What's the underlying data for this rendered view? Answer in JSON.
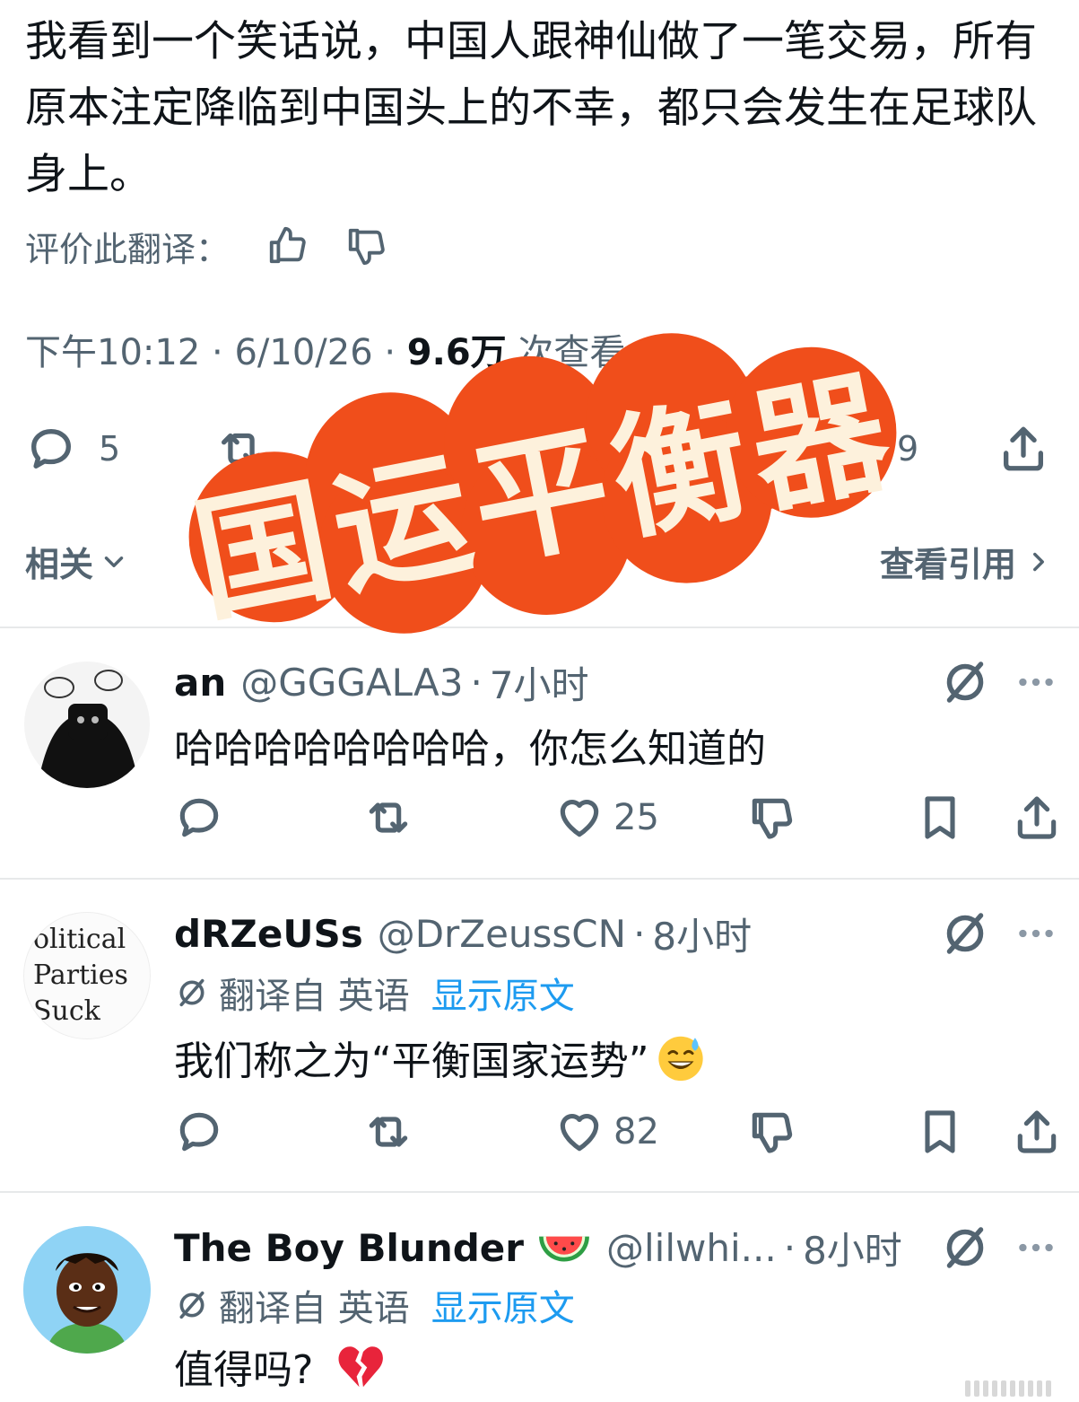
{
  "tweet": {
    "text": "我看到一个笑话说，中国人跟神仙做了一笔交易，所有原本注定降临到中国头上的不幸，都只会发生在足球队身上。",
    "rate_label": "评价此翻译：",
    "time": "下午10:12",
    "date": "6/10/26",
    "views_count": "9.6万",
    "views_label": "次查看",
    "reply_count": "5",
    "like_count_partial": "9",
    "related_label": "相关",
    "view_quotes_label": "查看引用"
  },
  "overlay": {
    "stamp_text": "国运平衡器",
    "stamp_color": "#f04e1b",
    "stamp_text_color": "#fdf1dc"
  },
  "replies": [
    {
      "name": "an",
      "handle": "@GGGALA3",
      "separator": "·",
      "time": "7小时",
      "text": "哈哈哈哈哈哈哈哈，你怎么知道的",
      "like_count": "25"
    },
    {
      "name": "dRZeUSs",
      "handle": "@DrZeussCN",
      "separator": "·",
      "time": "8小时",
      "translated_label": "翻译自 英语",
      "show_original": "显示原文",
      "text": "我们称之为“平衡国家运势”",
      "like_count": "82",
      "avatar_text": [
        "olitical",
        "Parties",
        "Suck"
      ]
    },
    {
      "name": "The Boy Blunder",
      "handle": "@lilwhi...",
      "separator": "·",
      "time": "8小时",
      "translated_label": "翻译自 英语",
      "show_original": "显示原文",
      "text": "值得吗?"
    }
  ],
  "colors": {
    "text_primary": "#0f1419",
    "text_secondary": "#536471",
    "link": "#1d9bf0",
    "divider": "#e7e9ea"
  },
  "icons": [
    "reply-icon",
    "retweet-icon",
    "like-icon",
    "dislike-icon",
    "bookmark-icon",
    "share-icon",
    "translate-icon",
    "more-icon",
    "thumbs-up-icon",
    "thumbs-down-icon",
    "chevron-down-icon",
    "chevron-right-icon"
  ]
}
